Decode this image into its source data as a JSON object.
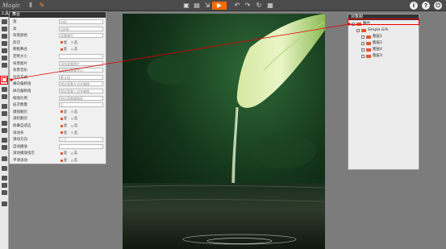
{
  "app": {
    "logo": "Magic"
  },
  "toolbar": {
    "left_icons": [
      "bar-chart-icon",
      "brush-icon"
    ],
    "center_icons": [
      "save-icon",
      "save-as-icon",
      "export-icon",
      "play-icon",
      "undo-icon",
      "redo-icon",
      "history-icon",
      "grid-icon"
    ],
    "right_icons": [
      "info-icon",
      "help-icon",
      "power-icon"
    ]
  },
  "tools_panel": {
    "title": "工具"
  },
  "props_panel": {
    "title": "舞台",
    "rows": [
      {
        "label": "宽",
        "value": "640"
      },
      {
        "label": "高",
        "value": "1008"
      },
      {
        "label": "背景颜色",
        "value": "背景颜色"
      },
      {
        "label": "剪切",
        "toggle": "on"
      },
      {
        "label": "图框舞台",
        "toggle": "on"
      },
      {
        "label": "定制大小",
        "value": ""
      },
      {
        "label": "背景图片",
        "value": "添加背景图片"
      },
      {
        "label": "背景音乐",
        "value": "请添加背景音乐"
      },
      {
        "label": "对齐方式",
        "value": "默认值"
      },
      {
        "label": "横向偏移值",
        "value": "相对背景左对齐偏移"
      },
      {
        "label": "纵向偏移值",
        "value": "相对背景上对齐偏移"
      },
      {
        "label": "缩放比例",
        "value": "相对背景偏移值"
      },
      {
        "label": "层次数量",
        "value": "3"
      },
      {
        "label": "键盘翻页",
        "toggle": "on"
      },
      {
        "label": "滚轮翻页",
        "toggle": "on"
      },
      {
        "label": "屏幕自适应",
        "toggle": "on"
      },
      {
        "label": "滚动条",
        "toggle": "on"
      },
      {
        "label": "滑动方向",
        "value": "上下"
      },
      {
        "label": "自动播放",
        "value": ""
      },
      {
        "label": "滚动播放指示",
        "toggle": "on"
      },
      {
        "label": "平滑滚动",
        "toggle": "on"
      }
    ],
    "toggle_yes": "是",
    "toggle_no": "否"
  },
  "objects_panel": {
    "title": "对象树",
    "items": [
      {
        "label": "舞台",
        "level": 0
      },
      {
        "label": "Simple Gifs",
        "level": 1
      },
      {
        "label": "图层1",
        "level": 2
      },
      {
        "label": "图层2",
        "level": 2
      },
      {
        "label": "图层4",
        "level": 2
      },
      {
        "label": "图层3",
        "level": 2
      }
    ]
  },
  "colors": {
    "accent": "#ff6a00",
    "highlight": "#e00000",
    "toggle_on": "#e4572e"
  }
}
